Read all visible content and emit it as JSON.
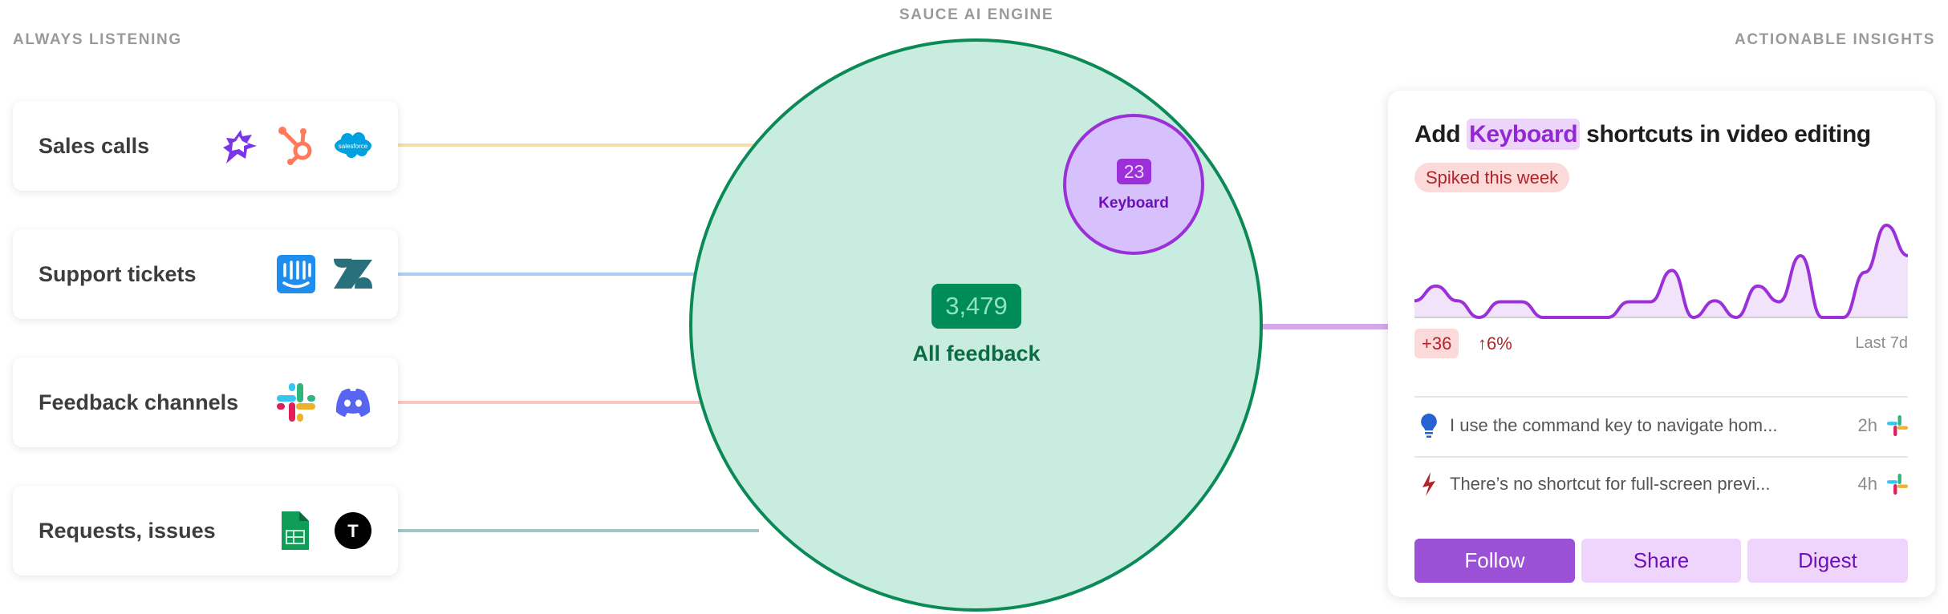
{
  "headers": {
    "left": "ALWAYS LISTENING",
    "center": "SAUCE AI ENGINE",
    "right": "ACTIONABLE INSIGHTS"
  },
  "sources": [
    {
      "label": "Sales calls",
      "icons": [
        "gong-icon",
        "hubspot-icon",
        "salesforce-icon"
      ],
      "line_color": "#f5dfa8"
    },
    {
      "label": "Support tickets",
      "icons": [
        "intercom-icon",
        "zendesk-icon"
      ],
      "line_color": "#a9cff4"
    },
    {
      "label": "Feedback channels",
      "icons": [
        "slack-icon",
        "discord-icon"
      ],
      "line_color": "#f9c8c0"
    },
    {
      "label": "Requests, issues",
      "icons": [
        "google-sheets-icon",
        "typeform-icon"
      ],
      "line_color": "#a3c7c5"
    }
  ],
  "salesforce_logo_text": "salesforce",
  "typeform_logo_text": "T",
  "engine": {
    "count": "3,479",
    "label": "All feedback",
    "topic_count": "23",
    "topic_label": "Keyboard",
    "color": "#008c58",
    "topic_color": "#9b30d9"
  },
  "insight": {
    "title_pre": "Add",
    "title_highlight": "Keyboard",
    "title_post": "shortcuts in video editing",
    "badge": "Spiked this week",
    "delta": "+36",
    "pct": "↑6%",
    "range": "Last 7d",
    "items": [
      {
        "icon": "lightbulb-icon",
        "text": "I use the command key to navigate hom...",
        "time": "2h",
        "source": "slack-icon"
      },
      {
        "icon": "lightning-icon",
        "text": "There’s no shortcut for full-screen previ...",
        "time": "4h",
        "source": "slack-icon"
      }
    ],
    "buttons": {
      "follow": "Follow",
      "share": "Share",
      "digest": "Digest"
    }
  },
  "chart_data": {
    "type": "area",
    "title": "",
    "values": [
      1.8,
      3.4,
      1.8,
      0,
      1.7,
      1.7,
      0,
      0,
      0,
      0,
      1.7,
      1.7,
      5.1,
      0,
      1.8,
      0,
      3.4,
      1.7,
      6.7,
      0,
      0,
      4.9,
      10,
      6.7
    ],
    "color": "#9b30d9"
  }
}
